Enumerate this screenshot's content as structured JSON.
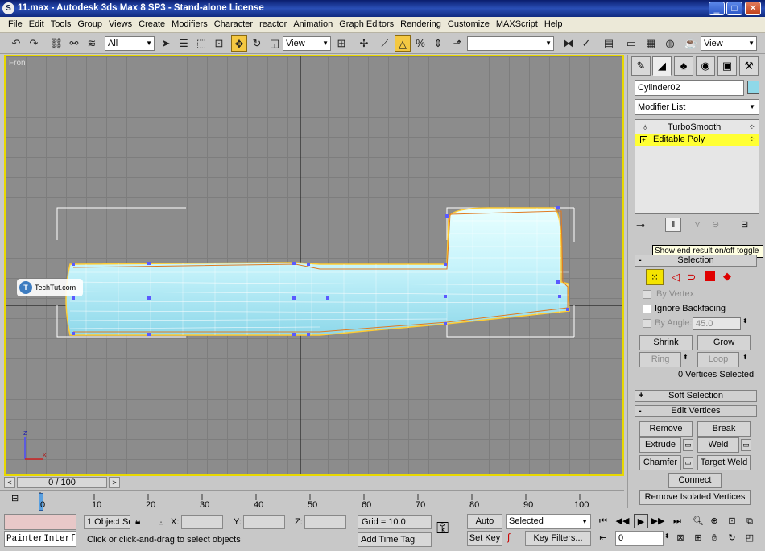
{
  "window": {
    "title": "11.max - Autodesk 3ds Max 8 SP3 - Stand-alone License",
    "icon_glyph": "S"
  },
  "menu": [
    "File",
    "Edit",
    "Tools",
    "Group",
    "Views",
    "Create",
    "Modifiers",
    "Character",
    "reactor",
    "Animation",
    "Graph Editors",
    "Rendering",
    "Customize",
    "MAXScript",
    "Help"
  ],
  "toolbar": {
    "selection_filter": "All",
    "ref_coord": "View",
    "named_selection": "",
    "view_right": "View"
  },
  "viewport": {
    "label": "Fron",
    "watermark": "TechTut.com",
    "axis_z": "z",
    "axis_x": "x"
  },
  "panel": {
    "object_name": "Cylinder02",
    "object_color": "#8fd8e8",
    "modifier_list": "Modifier List",
    "stack": [
      {
        "label": "TurboSmooth",
        "selected": false
      },
      {
        "label": "Editable Poly",
        "selected": true
      }
    ],
    "tooltip": "Show end result on/off toggle",
    "selection_rollout": "Selection",
    "by_vertex": "By Vertex",
    "ignore_backfacing": "Ignore Backfacing",
    "by_angle": "By Angle:",
    "angle_value": "45.0",
    "shrink": "Shrink",
    "grow": "Grow",
    "ring": "Ring",
    "loop": "Loop",
    "selected_count": "0 Vertices Selected",
    "soft_selection": "Soft Selection",
    "edit_vertices": "Edit Vertices",
    "remove": "Remove",
    "break": "Break",
    "extrude": "Extrude",
    "weld": "Weld",
    "chamfer": "Chamfer",
    "target_weld": "Target Weld",
    "connect": "Connect",
    "remove_isolated": "Remove Isolated Vertices"
  },
  "timeline": {
    "frame": "0 / 100",
    "ticks": [
      "0",
      "10",
      "20",
      "30",
      "40",
      "50",
      "60",
      "70",
      "80",
      "90",
      "100"
    ]
  },
  "status": {
    "listener": "PainterInterf",
    "selection_count": "1 Object Se",
    "x_label": "X:",
    "y_label": "Y:",
    "z_label": "Z:",
    "grid": "Grid = 10.0",
    "prompt": "Click or click-and-drag to select objects",
    "add_time_tag": "Add Time Tag",
    "auto_key": "Auto Key",
    "set_key": "Set Key",
    "key_mode": "Selected",
    "key_filters": "Key Filters...",
    "current_frame": "0"
  }
}
